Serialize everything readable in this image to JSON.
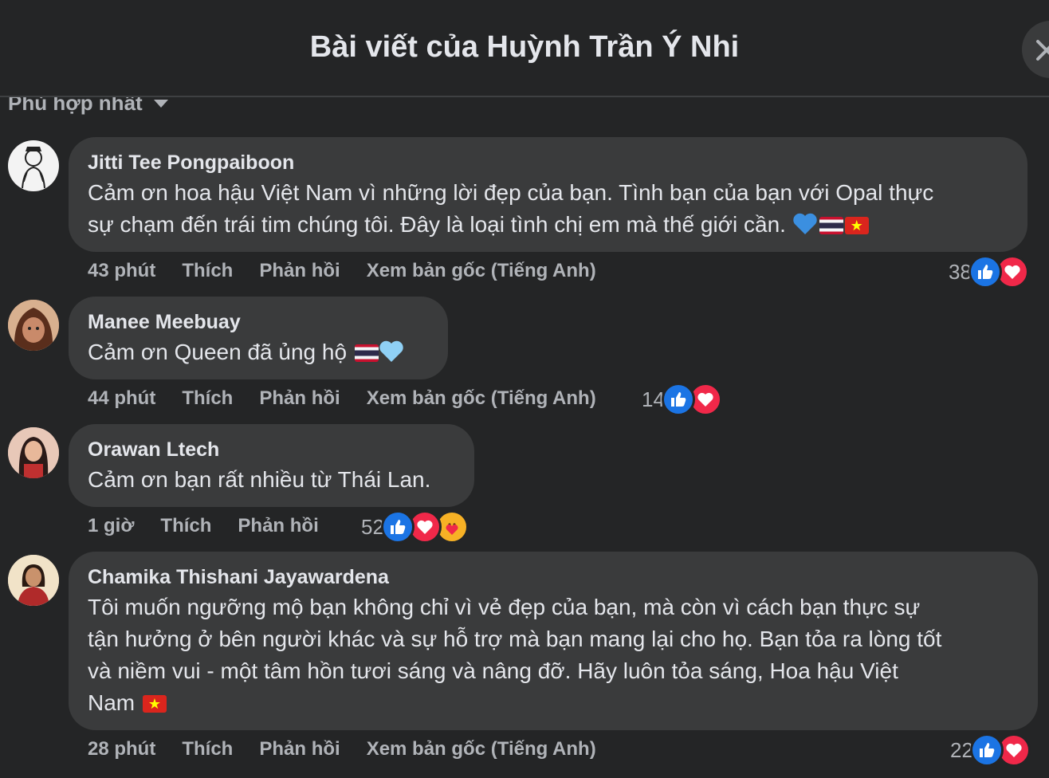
{
  "header": {
    "title": "Bài viết của Huỳnh Trần Ý Nhi"
  },
  "sort": {
    "label": "Phù hợp nhất"
  },
  "comments": [
    {
      "name": "Jitti Tee Pongpaiboon",
      "text_line1": "Cảm ơn hoa hậu Việt Nam vì những lời đẹp của bạn. Tình bạn của bạn với Opal thực",
      "text_line2": "sự chạm đến trái tim chúng tôi. Đây là loại tình chị em mà thế giới cần.",
      "time": "43 phút",
      "like": "Thích",
      "reply": "Phản hồi",
      "translate": "Xem bản gốc (Tiếng Anh)",
      "reaction_count": "38"
    },
    {
      "name": "Manee Meebuay",
      "text": "Cảm ơn Queen đã ủng hộ",
      "time": "44 phút",
      "like": "Thích",
      "reply": "Phản hồi",
      "translate": "Xem bản gốc (Tiếng Anh)",
      "reaction_count": "14"
    },
    {
      "name": "Orawan Ltech",
      "text": "Cảm ơn bạn rất nhiều từ Thái Lan.",
      "time": "1 giờ",
      "like": "Thích",
      "reply": "Phản hồi",
      "reaction_count": "52"
    },
    {
      "name": "Chamika Thishani Jayawardena",
      "text_line1": "Tôi muốn ngưỡng mộ bạn không chỉ vì vẻ đẹp của bạn, mà còn vì cách bạn thực sự",
      "text_line2": "tận hưởng ở bên người khác và sự hỗ trợ mà bạn mang lại cho họ. Bạn tỏa ra lòng tốt",
      "text_line3": "và niềm vui - một tâm hồn tươi sáng và nâng đỡ. Hãy luôn tỏa sáng, Hoa hậu Việt",
      "text_line4": "Nam",
      "time": "28 phút",
      "like": "Thích",
      "reply": "Phản hồi",
      "translate": "Xem bản gốc (Tiếng Anh)",
      "reaction_count": "22"
    }
  ],
  "colors": {
    "background": "#242526",
    "bubble": "#3a3b3c",
    "like": "#1b74e4",
    "love": "#f02849",
    "secondary_text": "#b0b3b8"
  },
  "icons": [
    "close-icon",
    "caret-down-icon",
    "like-reaction-icon",
    "love-reaction-icon",
    "care-reaction-icon",
    "blue-heart-emoji",
    "thai-flag-emoji",
    "vietnam-flag-emoji"
  ]
}
